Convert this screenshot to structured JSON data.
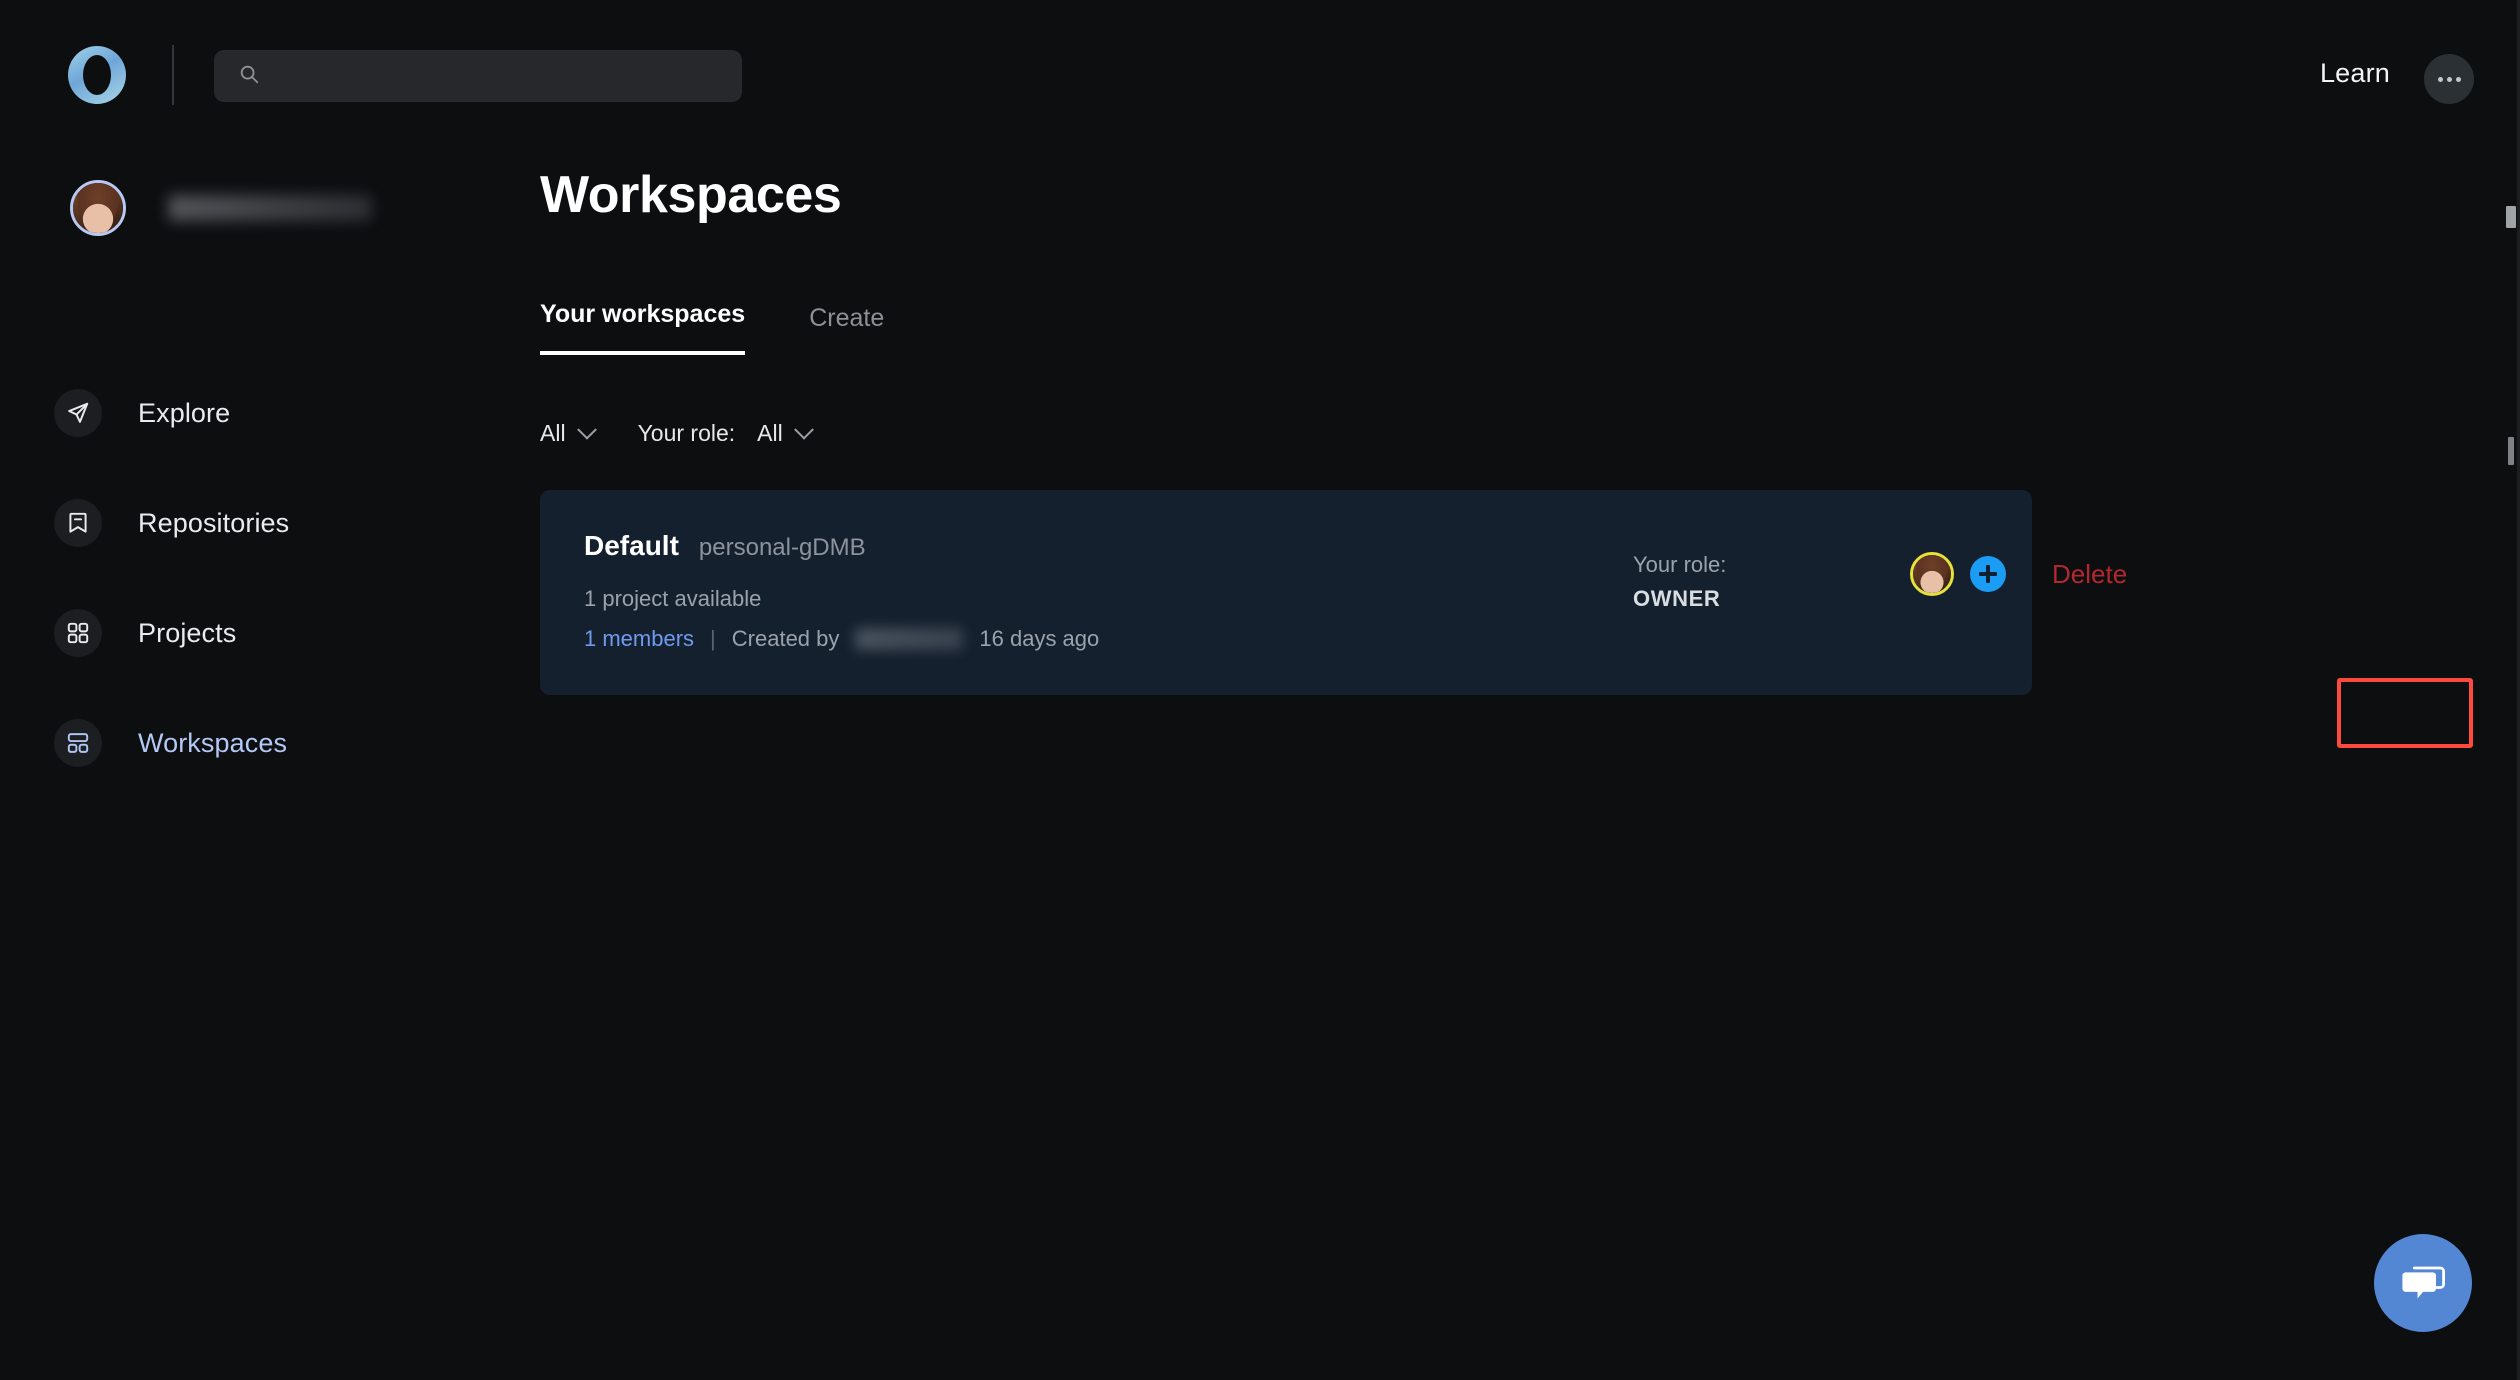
{
  "header": {
    "logo_icon": "circle-ring-logo",
    "search": {
      "placeholder": "",
      "value": "",
      "icon": "search-icon"
    },
    "learn_label": "Learn",
    "more_icon": "ellipsis-icon"
  },
  "sidebar": {
    "profile": {
      "avatar_icon": "user-avatar",
      "name": ""
    },
    "items": [
      {
        "label": "Explore",
        "icon": "send-icon",
        "active": false
      },
      {
        "label": "Repositories",
        "icon": "bookmark-minus-icon",
        "active": false
      },
      {
        "label": "Projects",
        "icon": "grid-four-icon",
        "active": false
      },
      {
        "label": "Workspaces",
        "icon": "layout-dashboard-icon",
        "active": true
      }
    ]
  },
  "main": {
    "page_title": "Workspaces",
    "tabs": [
      {
        "label": "Your workspaces",
        "active": true
      },
      {
        "label": "Create",
        "active": false
      }
    ],
    "filters": {
      "scope_value": "All",
      "role_label": "Your role:",
      "role_value": "All",
      "chevron_icon": "chevron-down-icon"
    },
    "workspaces": [
      {
        "name": "Default",
        "slug": "personal-gDMB",
        "projects_text": "1 project available",
        "members_link": "1 members",
        "separator": "|",
        "created_by_label": "Created by",
        "created_by_name": "",
        "created_age": "16 days ago",
        "role_label": "Your role:",
        "role_value": "OWNER",
        "member_avatar_icon": "member-avatar",
        "add_member_label": "+",
        "delete_label": "Delete"
      }
    ]
  },
  "overlay": {
    "highlight_target": "Delete",
    "highlight_color": "#fd4a3c"
  },
  "chat": {
    "icon": "chat-bubbles-icon",
    "color": "#5387d4"
  },
  "colors": {
    "background": "#0c0e10",
    "card_background": "#15202f",
    "accent_blue": "#6f9aee",
    "active_nav": "#b3c8f5",
    "delete_red": "#b3282f",
    "plus_blue": "#1b9df6",
    "avatar_ring": "#e6e23a"
  }
}
